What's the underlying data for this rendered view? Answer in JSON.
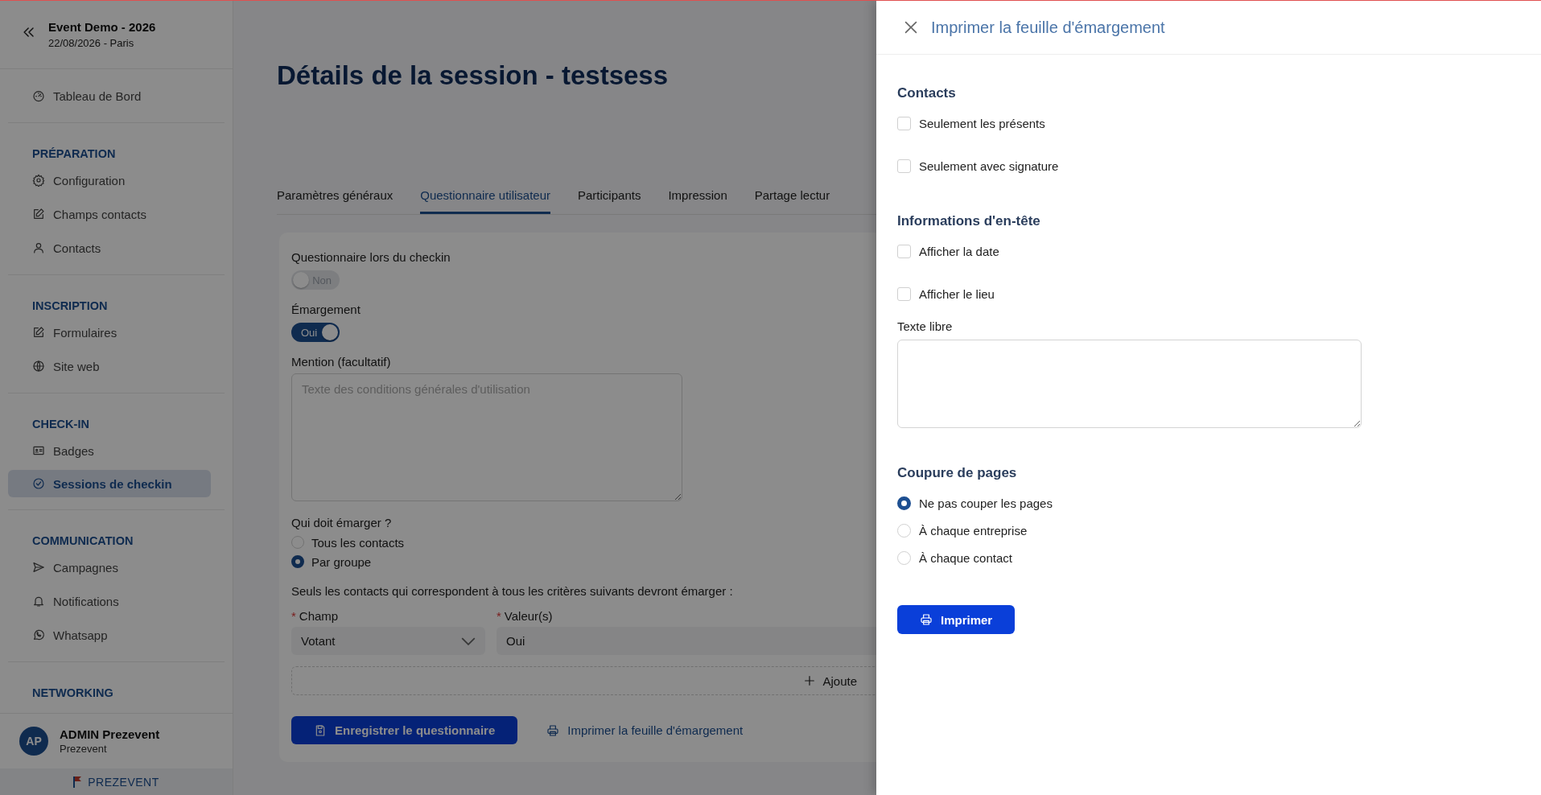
{
  "sidebar": {
    "event_title": "Event Demo - 2026",
    "event_date": "22/08/2026 - Paris",
    "sections": [
      {
        "items": [
          {
            "label": "Tableau de Bord",
            "selected": false
          }
        ]
      },
      {
        "heading": "PRÉPARATION",
        "items": [
          {
            "label": "Configuration",
            "selected": false
          },
          {
            "label": "Champs contacts",
            "selected": false
          },
          {
            "label": "Contacts",
            "selected": false
          }
        ]
      },
      {
        "heading": "INSCRIPTION",
        "items": [
          {
            "label": "Formulaires",
            "selected": false
          },
          {
            "label": "Site web",
            "selected": false
          }
        ]
      },
      {
        "heading": "CHECK-IN",
        "items": [
          {
            "label": "Badges",
            "selected": false
          },
          {
            "label": "Sessions de checkin",
            "selected": true
          }
        ]
      },
      {
        "heading": "COMMUNICATION",
        "items": [
          {
            "label": "Campagnes",
            "selected": false
          },
          {
            "label": "Notifications",
            "selected": false
          },
          {
            "label": "Whatsapp",
            "selected": false
          }
        ]
      },
      {
        "heading": "NETWORKING"
      }
    ],
    "user": {
      "initials": "AP",
      "name": "ADMIN Prezevent",
      "org": "Prezevent"
    },
    "brand": "PREZEVENT"
  },
  "main": {
    "title": "Détails de la session - testsess",
    "tabs": [
      {
        "label": "Paramètres généraux",
        "selected": false
      },
      {
        "label": "Questionnaire utilisateur",
        "selected": true
      },
      {
        "label": "Participants",
        "selected": false
      },
      {
        "label": "Impression",
        "selected": false
      },
      {
        "label": "Partage lectur",
        "selected": false
      }
    ],
    "toggles": [
      {
        "label": "Questionnaire lors du checkin",
        "on": false,
        "text": "Non"
      },
      {
        "label": "Émargement",
        "on": true,
        "text": "Oui"
      }
    ],
    "mention": {
      "label": "Mention (facultatif)",
      "placeholder": "Texte des conditions générales d'utilisation"
    },
    "who": {
      "label": "Qui doit émarger ?",
      "options": [
        {
          "label": "Tous les contacts",
          "selected": false
        },
        {
          "label": "Par groupe",
          "selected": true
        }
      ]
    },
    "criteria_note": "Seuls les contacts qui correspondent à tous les critères suivants devront émarger :",
    "criteria": [
      {
        "label": "Champ",
        "required_mark": "*",
        "value": "Votant",
        "kind": "select"
      },
      {
        "label": "Valeur(s)",
        "required_mark": "*",
        "value": "Oui",
        "kind": "text"
      }
    ],
    "add_button": "Ajoute",
    "save_button": "Enregistrer le questionnaire",
    "print_link": "Imprimer la feuille d'émargement"
  },
  "drawer": {
    "title": "Imprimer la feuille d'émargement",
    "sections": [
      {
        "heading": "Contacts",
        "kind": "checkboxes",
        "options": [
          {
            "label": "Seulement les présents",
            "checked": false
          },
          {
            "label": "Seulement avec signature",
            "checked": false
          }
        ]
      },
      {
        "heading": "Informations d'en-tête",
        "kind": "checkboxes",
        "options": [
          {
            "label": "Afficher la date",
            "checked": false
          },
          {
            "label": "Afficher le lieu",
            "checked": false
          }
        ],
        "textarea_label": "Texte libre"
      },
      {
        "heading": "Coupure de pages",
        "kind": "radios",
        "options": [
          {
            "label": "Ne pas couper les pages",
            "selected": true
          },
          {
            "label": "À chaque entreprise",
            "selected": false
          },
          {
            "label": "À chaque contact",
            "selected": false
          }
        ]
      }
    ],
    "button": "Imprimer"
  }
}
